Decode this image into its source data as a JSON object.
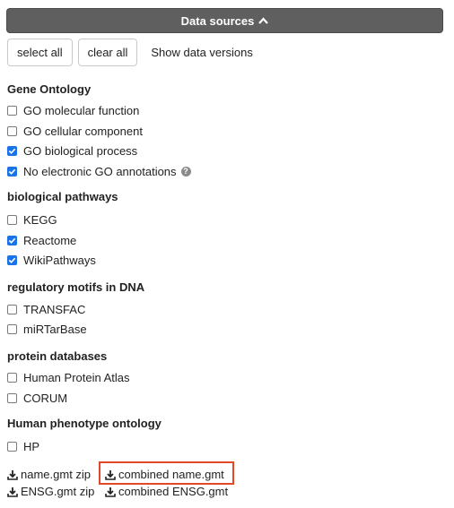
{
  "header": {
    "title": "Data sources"
  },
  "toolbar": {
    "select_all": "select all",
    "clear_all": "clear all",
    "show_versions": "Show data versions"
  },
  "sections": [
    {
      "title": "Gene Ontology",
      "options": [
        {
          "label": "GO molecular function",
          "checked": false
        },
        {
          "label": "GO cellular component",
          "checked": false
        },
        {
          "label": "GO biological process",
          "checked": true
        },
        {
          "label": "No electronic GO annotations",
          "checked": true
        }
      ]
    },
    {
      "title": "biological pathways",
      "options": [
        {
          "label": "KEGG",
          "checked": false
        },
        {
          "label": "Reactome",
          "checked": true
        },
        {
          "label": "WikiPathways",
          "checked": true
        }
      ]
    },
    {
      "title": "regulatory motifs in DNA",
      "options": [
        {
          "label": "TRANSFAC",
          "checked": false
        },
        {
          "label": "miRTarBase",
          "checked": false
        }
      ]
    },
    {
      "title": "protein databases",
      "options": [
        {
          "label": "Human Protein Atlas",
          "checked": false
        },
        {
          "label": "CORUM",
          "checked": false
        }
      ]
    },
    {
      "title": "Human phenotype ontology",
      "options": [
        {
          "label": "HP",
          "checked": false
        }
      ]
    }
  ],
  "downloads": {
    "name_zip": "name.gmt zip",
    "combined_name": "combined name.gmt",
    "ensg_zip": "ENSG.gmt zip",
    "combined_ensg": "combined ENSG.gmt"
  },
  "colors": {
    "header_bg": "#5f5f5f",
    "checkbox_on": "#1a73e8",
    "highlight": "#e04a2a"
  }
}
